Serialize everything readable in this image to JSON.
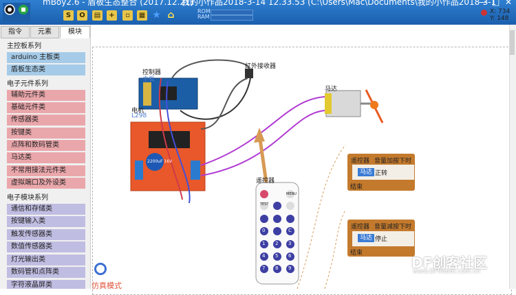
{
  "header": {
    "app_title": "mBoy2.6 - 盾板生态整合 (2017.12.21)",
    "doc_title": "我的小作品2018-3-14 12.33.53 (C:\\Users\\Mac\\Documents\\我的小作品2018-3-1",
    "rom_label": "ROM",
    "ram_label": "RAM",
    "toolbar_glyphs": {
      "s": "S",
      "o": "O"
    }
  },
  "coords": {
    "x": "X: 734",
    "y": "Y: 148"
  },
  "tabs": [
    "指令",
    "元素",
    "模块"
  ],
  "sidebar": {
    "main_title": "主控板系列",
    "main_items": [
      "arduino 主板类",
      "盾板生态类"
    ],
    "elec_title": "电子元件系列",
    "elec_items": [
      "辅助元件类",
      "基础元件类",
      "传感器类",
      "按键类",
      "点阵和数码管类",
      "马达类",
      "不常用接法元件类",
      "虚拟端口及外设类"
    ],
    "module_title": "电子模块系列",
    "module_items": [
      "通信和存储类",
      "按键输入类",
      "触发传感器类",
      "数值传感器类",
      "灯光输出类",
      "数码管和点阵类",
      "字符液晶屏类"
    ]
  },
  "sim_label": "仿真模式",
  "canvas": {
    "controller_label": "控制器",
    "controller_sub": "主板",
    "ir_label": "红外接收器",
    "motor_label": "马达",
    "driver_label": "电机",
    "driver_sub": "L298",
    "remote_label": "遥控器",
    "remote_btns": [
      "TEST",
      "MENU",
      "0",
      "C",
      "1",
      "2",
      "3",
      "4",
      "5",
      "6",
      "7",
      "8",
      "9"
    ],
    "cap_text": "2200uF 16V"
  },
  "code_blocks": [
    {
      "head": "遥控器",
      "event": "音量加按下时",
      "target": "马达",
      "action": "正转",
      "end": "结束"
    },
    {
      "head": "遥控器",
      "event": "音量减按下时",
      "target": "马达",
      "action": "停止",
      "end": "结束"
    }
  ],
  "watermark": {
    "text": "DF创客社区",
    "url": "www.DFRobot.com.cn"
  }
}
